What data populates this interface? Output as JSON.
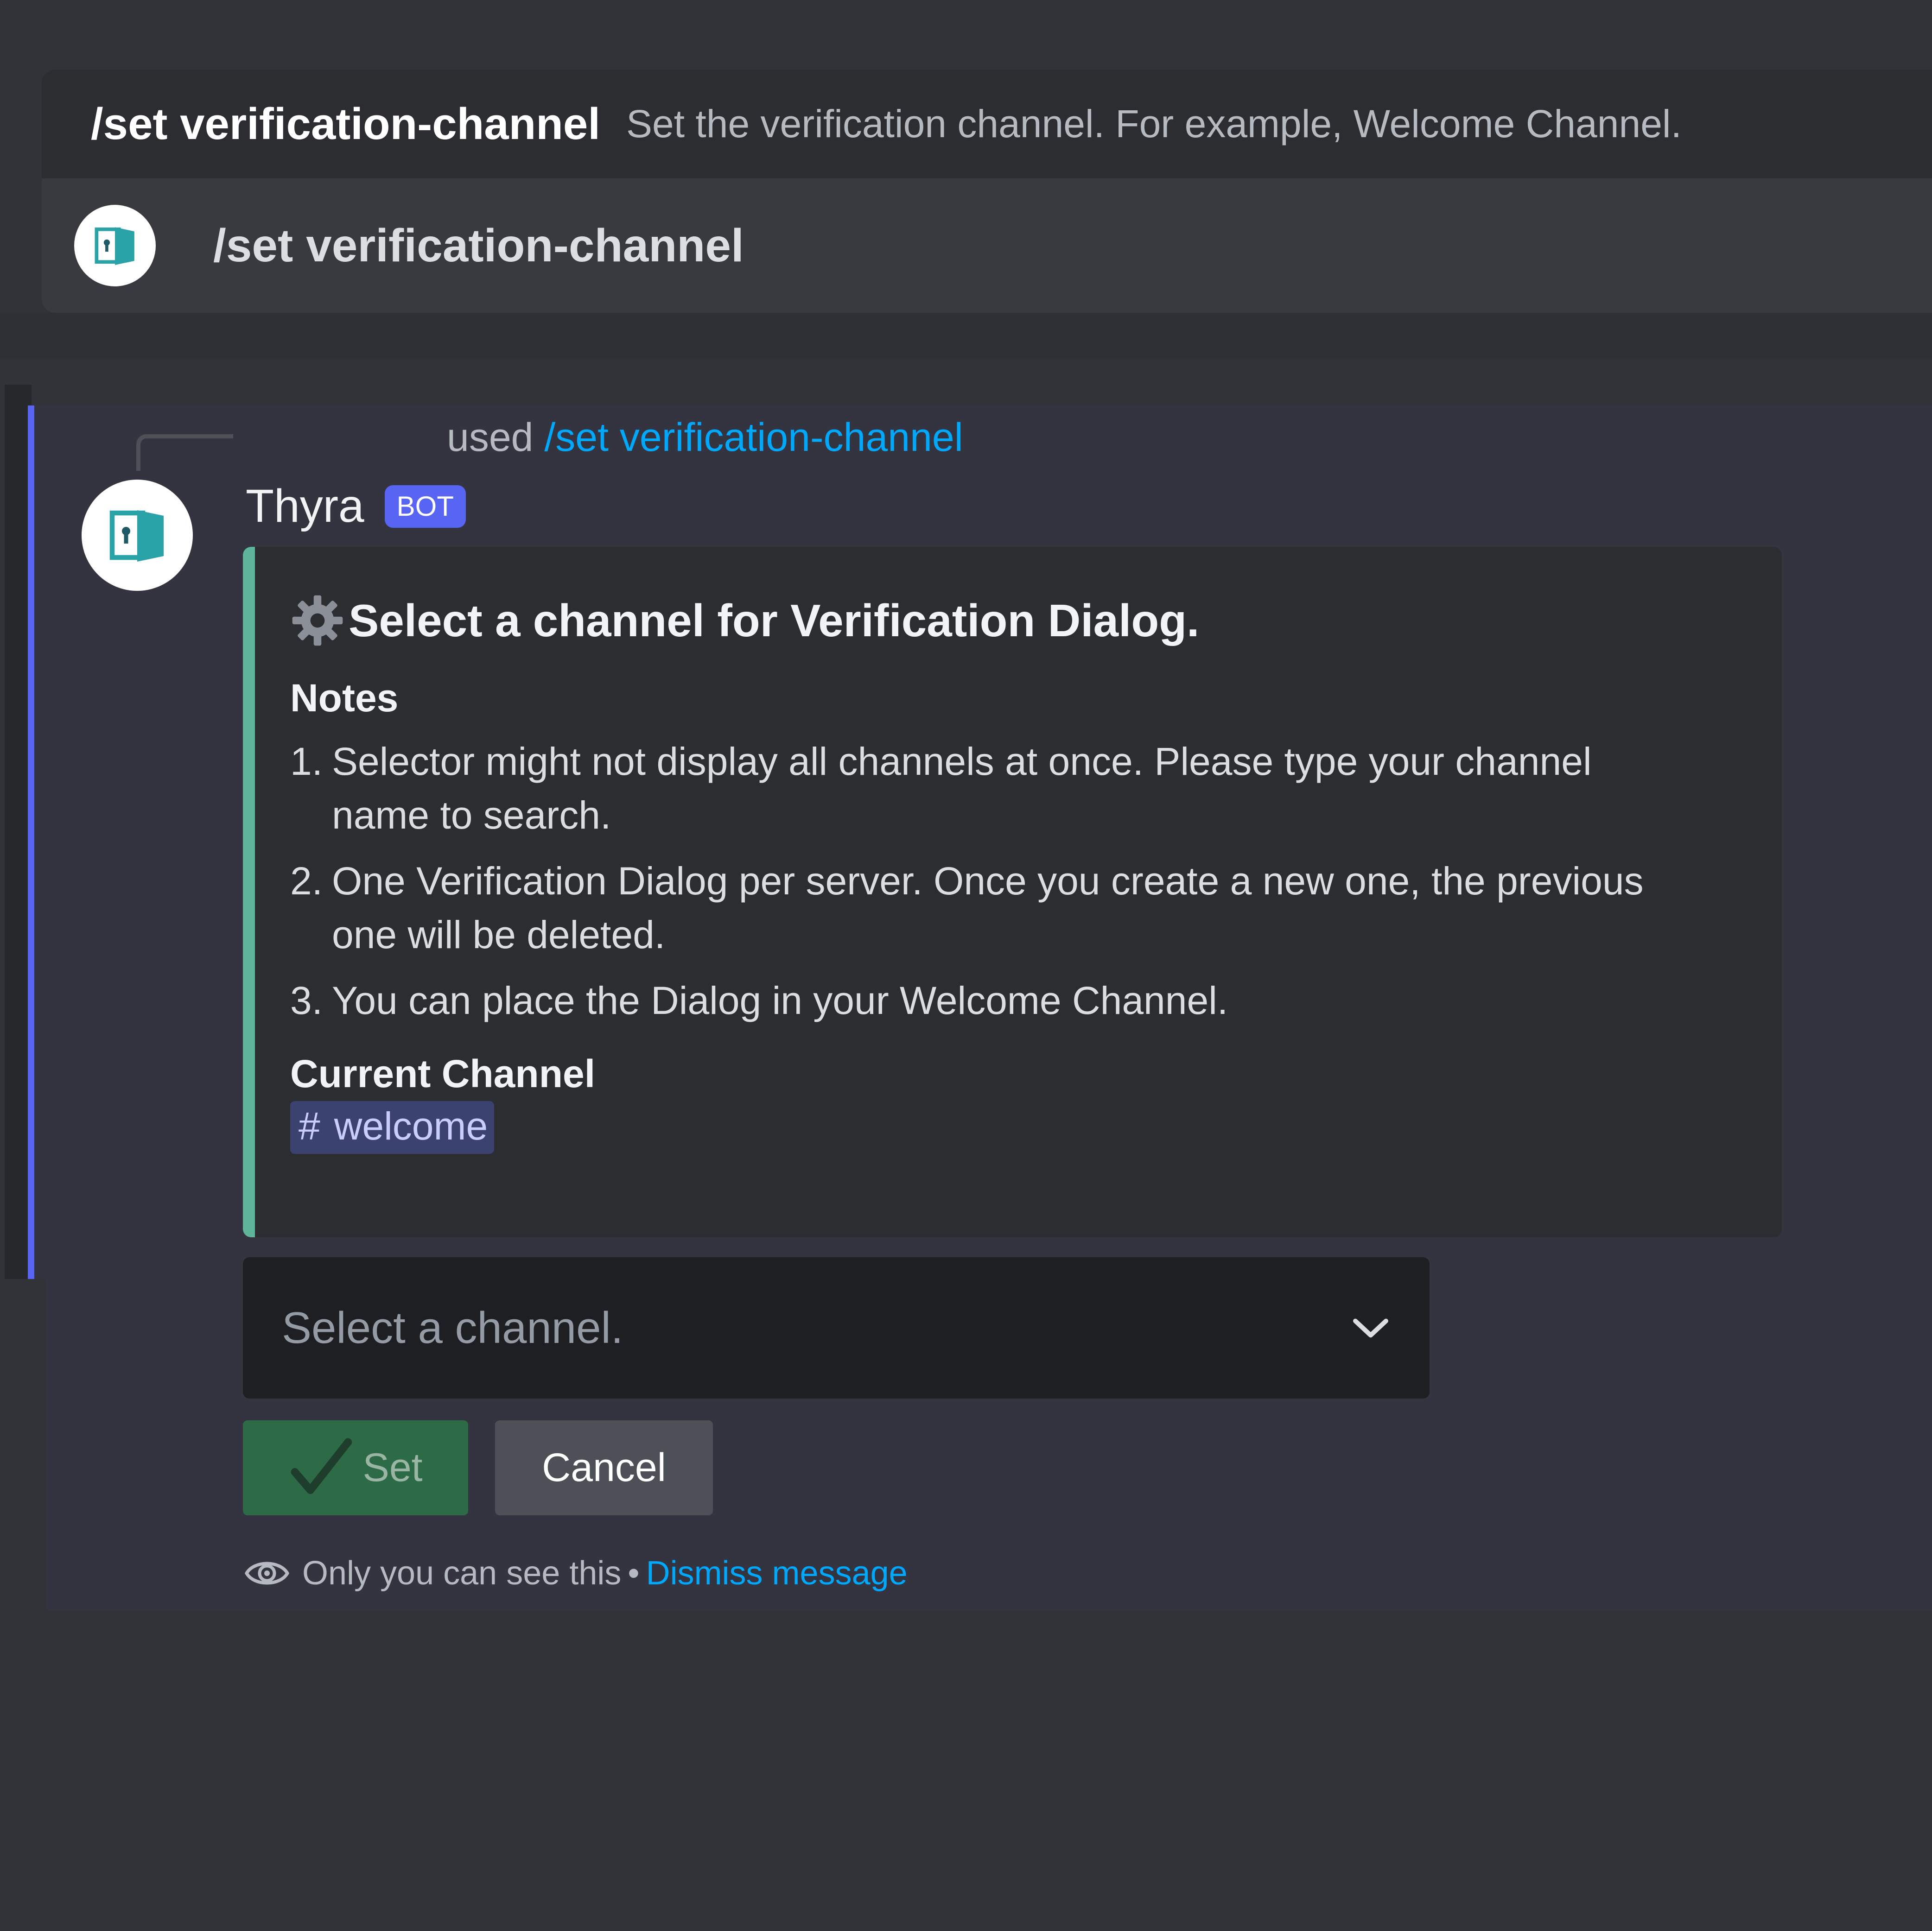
{
  "autocomplete": {
    "command_name": "/set verification-channel",
    "command_description": "Set the verification channel. For example, Welcome Channel.",
    "option_label": "/set verification-channel"
  },
  "message": {
    "reply": {
      "used_text": "used",
      "command": "/set verification-channel"
    },
    "author": "Thyra",
    "bot_tag": "BOT",
    "embed": {
      "accent_color": "#5fb59a",
      "title": "Select a channel for Verification Dialog.",
      "notes_title": "Notes",
      "notes": [
        {
          "num": "1.",
          "text": "Selector might not display all channels at once. Please type your channel name to search."
        },
        {
          "num": "2.",
          "text": "One Verification Dialog per server. Once you create a new one, the previous one will be deleted."
        },
        {
          "num": "3.",
          "text": "You can place the Dialog in your Welcome Channel."
        }
      ],
      "current_channel_title": "Current Channel",
      "current_channel": "welcome"
    },
    "select": {
      "placeholder": "Select a channel."
    },
    "buttons": {
      "set_label": "Set",
      "cancel_label": "Cancel"
    },
    "ephemeral": {
      "notice": "Only you can see this",
      "separator": "•",
      "dismiss": "Dismiss message"
    }
  },
  "colors": {
    "background": "#313338",
    "blurple": "#5865f2",
    "link": "#00a8fc",
    "success": "#2d6b47"
  },
  "icons": [
    "door-logo-icon",
    "gear-icon",
    "hash-icon",
    "chevron-down-icon",
    "check-icon",
    "eye-icon"
  ]
}
